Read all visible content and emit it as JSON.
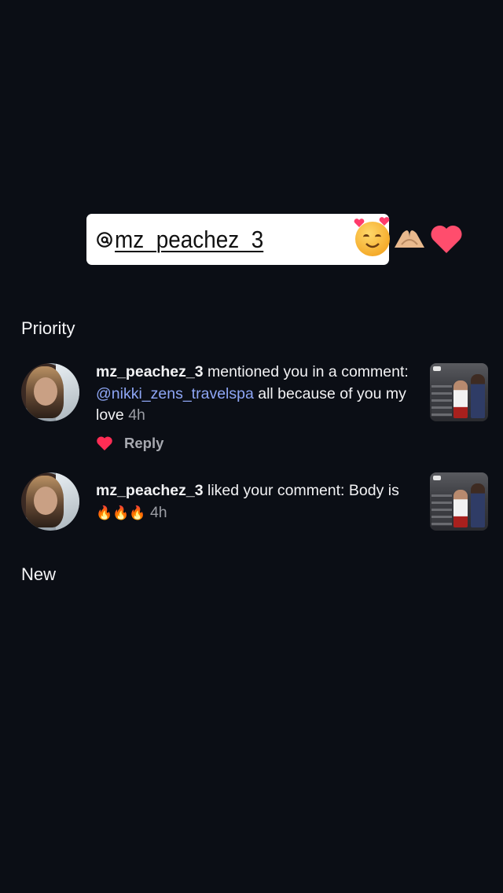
{
  "sticker": {
    "handle": "mz_peachez_3"
  },
  "sections": {
    "priority": "Priority",
    "new": "New"
  },
  "notifications": [
    {
      "username": "mz_peachez_3",
      "text_before": " mentioned you in a comment: ",
      "mention": "@nikki_zens_travelspa",
      "text_after": " all because of you my love ",
      "time": "4h",
      "reply_label": "Reply"
    },
    {
      "username": "mz_peachez_3",
      "text_before": " liked your comment: Body is ",
      "emoji": "🔥🔥🔥",
      "time": "4h"
    }
  ],
  "colors": {
    "background": "#0b0e15",
    "mention": "#8ea6f5",
    "muted": "#9a9ca3",
    "heart": "#ff2d55"
  }
}
